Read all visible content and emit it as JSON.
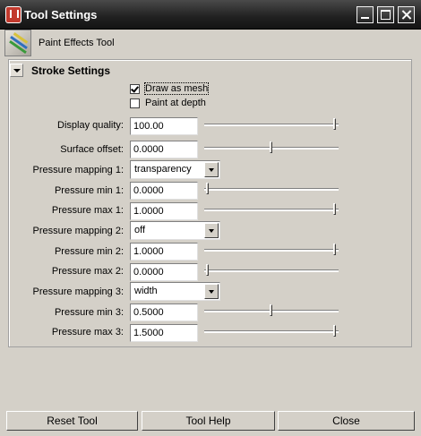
{
  "window": {
    "title": "Tool Settings"
  },
  "tool": {
    "name": "Paint Effects Tool"
  },
  "section": {
    "title": "Stroke Settings"
  },
  "checkboxes": [
    {
      "label": "Draw as mesh",
      "checked": true
    },
    {
      "label": "Paint at depth",
      "checked": false
    }
  ],
  "fields": {
    "display_quality": {
      "label": "Display quality:",
      "value": "100.00",
      "slider_fraction": 1.0
    },
    "surface_offset": {
      "label": "Surface offset:",
      "value": "0.0000",
      "slider_fraction": 0.5
    },
    "pressure_mapping_1": {
      "label": "Pressure mapping 1:",
      "value": "transparency"
    },
    "pressure_min_1": {
      "label": "Pressure min 1:",
      "value": "0.0000",
      "slider_fraction": 0.0
    },
    "pressure_max_1": {
      "label": "Pressure max 1:",
      "value": "1.0000",
      "slider_fraction": 1.0
    },
    "pressure_mapping_2": {
      "label": "Pressure mapping 2:",
      "value": "off"
    },
    "pressure_min_2": {
      "label": "Pressure min 2:",
      "value": "1.0000",
      "slider_fraction": 1.0
    },
    "pressure_max_2": {
      "label": "Pressure max 2:",
      "value": "0.0000",
      "slider_fraction": 0.0
    },
    "pressure_mapping_3": {
      "label": "Pressure mapping 3:",
      "value": "width"
    },
    "pressure_min_3": {
      "label": "Pressure min 3:",
      "value": "0.5000",
      "slider_fraction": 0.5
    },
    "pressure_max_3": {
      "label": "Pressure max 3:",
      "value": "1.5000",
      "slider_fraction": 1.0
    }
  },
  "buttons": {
    "reset": "Reset Tool",
    "help": "Tool Help",
    "close": "Close"
  },
  "icons": [
    "maya-app-icon",
    "minimize-icon",
    "maximize-icon",
    "close-icon",
    "paint-effects-icon",
    "collapse-arrow-icon"
  ]
}
